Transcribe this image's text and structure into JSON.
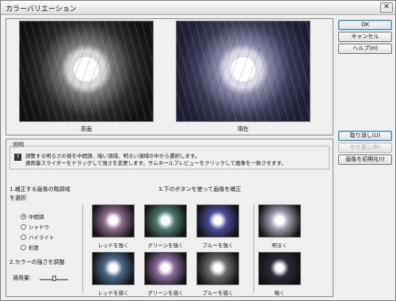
{
  "window": {
    "title": "カラーバリエーション",
    "close_glyph": "✕"
  },
  "preview": {
    "original_label": "原画",
    "current_label": "現在"
  },
  "buttons": {
    "ok": "OK",
    "cancel": "キャンセル",
    "help": "ヘルプ(H)",
    "undo": "取り消し(U)",
    "redo": "やり直し(R)",
    "reset": "画像を初期化(I)"
  },
  "description": {
    "group_label": "説明",
    "line1": "調整する明るさの値を中間調、暗い領域、明るい領域の中から選択します。",
    "line2": "適用量スライダーをドラッグして強さを変更します。サムネールプレビューをクリックして画像を一致させます。"
  },
  "tones": {
    "heading_line1": "1.補正する画像の階調域",
    "heading_line2": "を選択",
    "options": [
      "中間調",
      "シャドウ",
      "ハイライト",
      "彩度"
    ],
    "selected": "中間調"
  },
  "intensity": {
    "heading": "2.カラーの強さを調整",
    "amount_label": "適用量:"
  },
  "adjust": {
    "heading": "3.下のボタンを使って画像を補正",
    "thumbnails": [
      {
        "label": "レッドを強く",
        "tint": "#8a6a8a"
      },
      {
        "label": "グリーンを強く",
        "tint": "#4f7a72"
      },
      {
        "label": "ブルーを強く",
        "tint": "#4a4a9a"
      },
      {
        "label": "明るく",
        "tint": "#9a9aaa"
      },
      {
        "label": "レッドを弱く",
        "tint": "#4a6a8a"
      },
      {
        "label": "グリーンを弱く",
        "tint": "#8a6a9a"
      },
      {
        "label": "ブルーを弱く",
        "tint": "#6a6a6a"
      },
      {
        "label": "暗く",
        "tint": "#2a2a3a"
      }
    ]
  }
}
